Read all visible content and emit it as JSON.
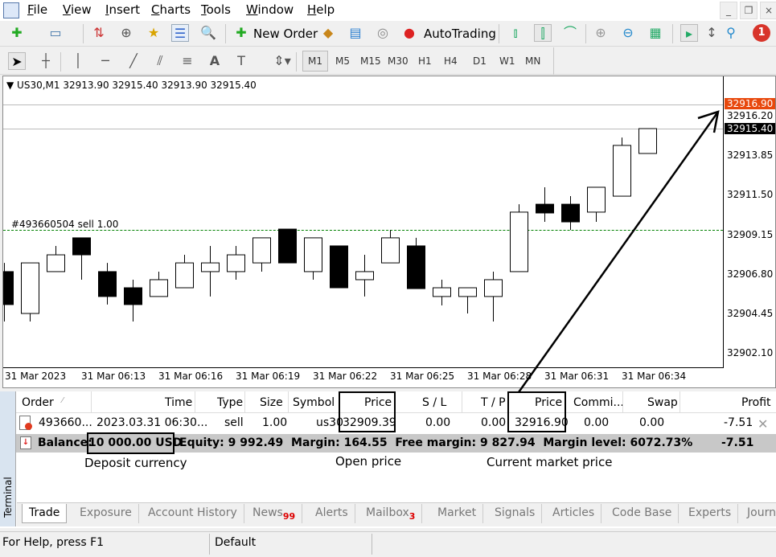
{
  "menu": {
    "items": [
      "File",
      "View",
      "Insert",
      "Charts",
      "Tools",
      "Window",
      "Help"
    ]
  },
  "toolbar": {
    "new_order": "New Order",
    "autotrading": "AutoTrading",
    "notification_count": "1"
  },
  "timeframes": [
    "M1",
    "M5",
    "M15",
    "M30",
    "H1",
    "H4",
    "D1",
    "W1",
    "MN"
  ],
  "active_timeframe": "M1",
  "chart_info": "US30,M1  32913.90 32915.40 32913.90 32915.40",
  "order_line_label": "#493660504 sell 1.00",
  "price_labels": [
    "32916.20",
    "32913.85",
    "32911.50",
    "32909.15",
    "32906.80",
    "32904.45",
    "32902.10"
  ],
  "ask_label": "32916.90",
  "bid_label": "32915.40",
  "time_labels": [
    "31 Mar 2023",
    "31 Mar 06:13",
    "31 Mar 06:16",
    "31 Mar 06:19",
    "31 Mar 06:22",
    "31 Mar 06:25",
    "31 Mar 06:28",
    "31 Mar 06:31",
    "31 Mar 06:34"
  ],
  "colors": {
    "ask_bg": "#e8480c",
    "bid_bg": "#000000",
    "order_line": "#008000",
    "summary_bg": "#c8c8c8"
  },
  "candles": [
    [
      32906.89,
      32907.41,
      32903.92,
      32904.93
    ],
    [
      32904.4,
      32907.41,
      32903.92,
      32907.41
    ],
    [
      32906.89,
      32908.42,
      32906.89,
      32907.89
    ],
    [
      32908.9,
      32908.9,
      32906.41,
      32907.89
    ],
    [
      32906.89,
      32907.41,
      32904.93,
      32905.41
    ],
    [
      32905.93,
      32906.41,
      32903.92,
      32904.93
    ],
    [
      32905.41,
      32906.89,
      32905.41,
      32906.41
    ],
    [
      32905.93,
      32907.89,
      32905.93,
      32907.41
    ],
    [
      32906.89,
      32908.42,
      32905.41,
      32907.41
    ],
    [
      32906.89,
      32908.42,
      32906.41,
      32907.89
    ],
    [
      32907.41,
      32908.9,
      32906.89,
      32908.9
    ],
    [
      32909.42,
      32909.42,
      32907.41,
      32907.41
    ],
    [
      32906.89,
      32908.9,
      32906.41,
      32908.9
    ],
    [
      32908.42,
      32908.42,
      32905.93,
      32905.93
    ],
    [
      32906.41,
      32907.89,
      32905.41,
      32906.89
    ],
    [
      32907.41,
      32909.37,
      32907.41,
      32908.9
    ],
    [
      32908.42,
      32908.9,
      32905.88,
      32905.88
    ],
    [
      32905.41,
      32906.41,
      32904.88,
      32905.93
    ],
    [
      32905.41,
      32905.93,
      32904.4,
      32905.93
    ],
    [
      32905.41,
      32906.89,
      32903.92,
      32906.41
    ],
    [
      32906.89,
      32910.9,
      32906.89,
      32910.43
    ],
    [
      32910.9,
      32911.91,
      32909.85,
      32910.38
    ],
    [
      32910.9,
      32911.38,
      32909.37,
      32909.85
    ],
    [
      32910.43,
      32911.91,
      32909.85,
      32911.91
    ],
    [
      32911.38,
      32914.87,
      32911.38,
      32914.4
    ],
    [
      32913.92,
      32915.4,
      32913.92,
      32915.4
    ]
  ],
  "order_price": 32909.39,
  "terminal": {
    "side_label": "Terminal",
    "headers": [
      "Order",
      "Time",
      "Type",
      "Size",
      "Symbol",
      "Price",
      "S / L",
      "T / P",
      "Price",
      "Commi...",
      "Swap",
      "Profit"
    ],
    "row": [
      "493660...",
      "2023.03.31 06:30...",
      "sell",
      "1.00",
      "us30",
      "32909.39",
      "0.00",
      "0.00",
      "32916.90",
      "0.00",
      "0.00",
      "-7.51"
    ],
    "summary": {
      "balance_label": "Balance:",
      "balance": "10 000.00 USD",
      "rest": "Equity: 9 992.49  Margin: 164.55  Free margin: 9 827.94  Margin level: 6072.73%",
      "profit": "-7.51"
    },
    "annotations": {
      "deposit": "Deposit currency",
      "open": "Open price",
      "current": "Current market price"
    },
    "tabs": [
      {
        "label": "Trade"
      },
      {
        "label": "Exposure"
      },
      {
        "label": "Account History"
      },
      {
        "label": "News",
        "badge": "99"
      },
      {
        "label": "Alerts"
      },
      {
        "label": "Mailbox",
        "badge": "3"
      },
      {
        "label": "Market"
      },
      {
        "label": "Signals"
      },
      {
        "label": "Articles"
      },
      {
        "label": "Code Base"
      },
      {
        "label": "Experts"
      },
      {
        "label": "Journ"
      }
    ]
  },
  "status": {
    "help": "For Help, press F1",
    "profile": "Default"
  }
}
